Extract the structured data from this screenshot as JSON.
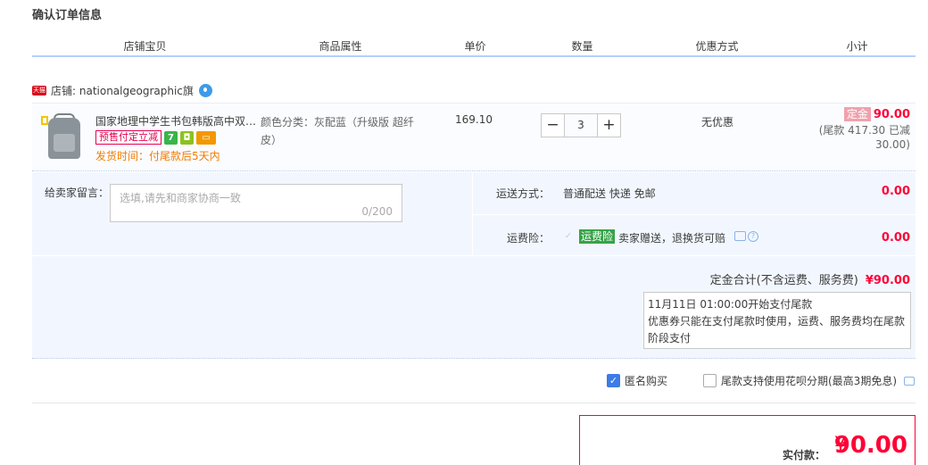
{
  "page_title": "确认订单信息",
  "columns": [
    "店铺宝贝",
    "商品属性",
    "单价",
    "数量",
    "优惠方式",
    "小计"
  ],
  "shop": {
    "badge": "天猫",
    "label": "店铺: nationalgeographic旗"
  },
  "item": {
    "name": "国家地理中学生书包韩版高中双…",
    "presale_tag": "预售付定立减",
    "badge_icons": [
      "seven-day-return-icon",
      "shield-icon",
      "credit-card-icon"
    ],
    "ship_time": "发货时间：付尾款后5天内",
    "attr": "颜色分类：灰配蓝（升级版 超纤皮）",
    "price": "169.10",
    "quantity": "3",
    "minus": "−",
    "plus": "+",
    "discount": "无优惠",
    "deposit_tag": "定金",
    "deposit_amount": "90.00",
    "balance": "(尾款 417.30 已减30.00)"
  },
  "message": {
    "label": "给卖家留言：",
    "placeholder": "选填,请先和商家协商一致",
    "count": "0/200"
  },
  "shipping": {
    "label": "运送方式：",
    "value": "普通配送 快递 免邮",
    "amount": "0.00"
  },
  "insurance": {
    "label": "运费险：",
    "tag": "运费险",
    "text": "卖家赠送，退换货可赔",
    "amount": "0.00"
  },
  "deposit_total": {
    "label": "定金合计(不含运费、服务费)",
    "amount": "¥90.00"
  },
  "notice": {
    "line1": "11月11日 01:00:00开始支付尾款",
    "line2": "优惠券只能在支付尾款时使用，运费、服务费均在尾款阶段支付"
  },
  "options": {
    "anonymous": "匿名购买",
    "huabei": "尾款支持使用花呗分期(最高3期免息)"
  },
  "payment": {
    "label": "实付款：",
    "yen": "¥",
    "amount": "90.00"
  },
  "colors": {
    "accent_red": "#ff0036",
    "header_line": "#b2d1ff",
    "panel_bg": "#f2f7ff",
    "checkbox_blue": "#3d7be6"
  }
}
